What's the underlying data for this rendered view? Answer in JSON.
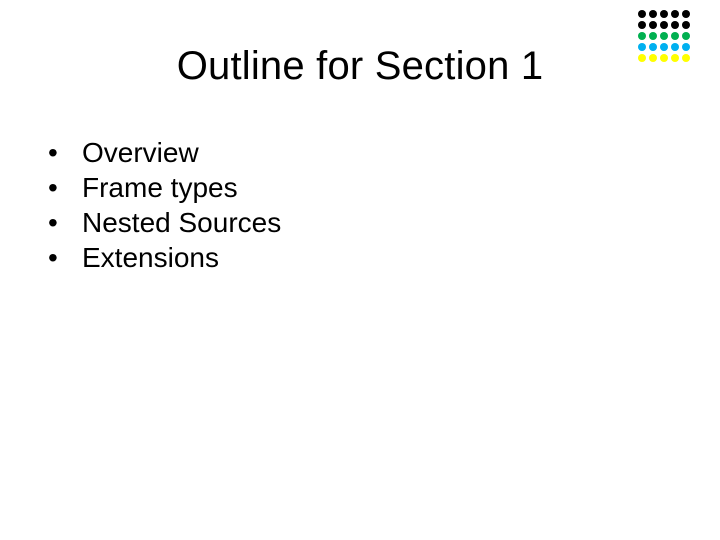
{
  "title": "Outline for Section 1",
  "bullets": [
    "Overview",
    "Frame types",
    "Nested Sources",
    "Extensions"
  ],
  "decoration": {
    "dot_rows": [
      {
        "count": 5,
        "color": "#000000"
      },
      {
        "count": 5,
        "color": "#000000"
      },
      {
        "count": 5,
        "color": "#00B050"
      },
      {
        "count": 5,
        "color": "#00B0F0"
      },
      {
        "count": 5,
        "color": "#FFFF00"
      }
    ]
  }
}
